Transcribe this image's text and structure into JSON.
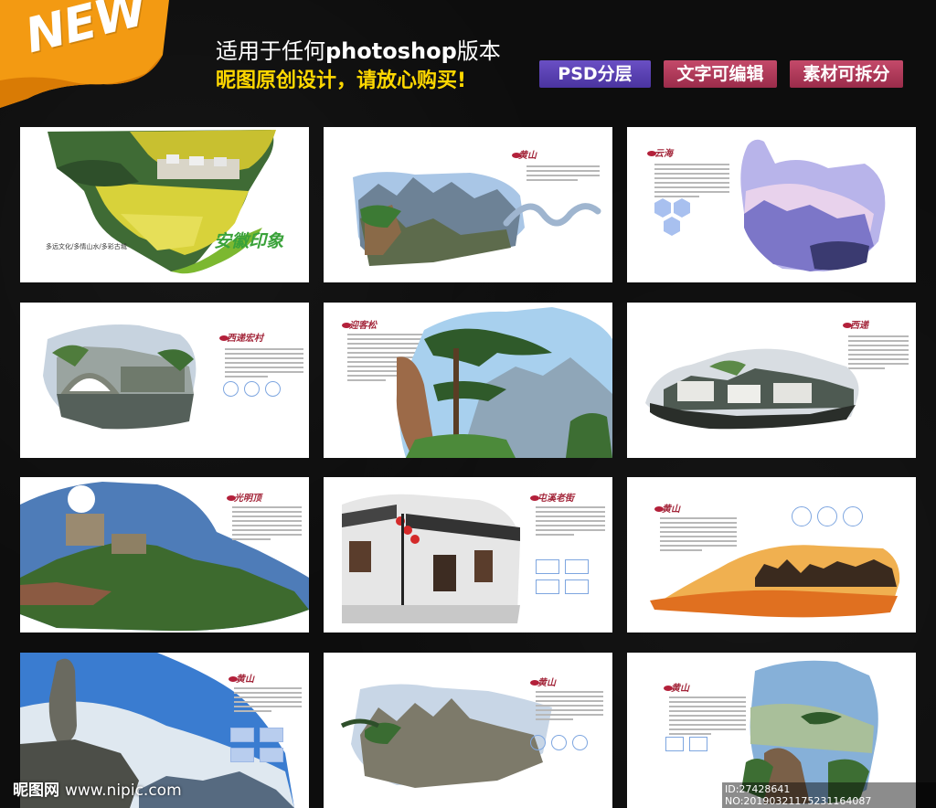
{
  "badge": {
    "label": "NEW",
    "color": "#f39a12"
  },
  "headline": {
    "line1_prefix": "适用于任何",
    "line1_bold": "photoshop",
    "line1_suffix": "版本",
    "line2": "昵图原创设计，请放心购买!"
  },
  "tags": [
    "PSD分层",
    "文字可编辑",
    "素材可拆分"
  ],
  "cards": [
    {
      "id": "cover",
      "title": "安徽印象",
      "subtitle": "多远文化/多情山水/多彩古城"
    },
    {
      "id": "huangshan-1",
      "title": "黄山"
    },
    {
      "id": "yunhai",
      "title": "云海"
    },
    {
      "id": "village-bridge",
      "title": "西递宏村"
    },
    {
      "id": "pine",
      "title": "迎客松"
    },
    {
      "id": "xidi",
      "title": "西递"
    },
    {
      "id": "guangmingding",
      "title": "光明顶"
    },
    {
      "id": "old-street",
      "title": "屯溪老街"
    },
    {
      "id": "sunset-peaks",
      "title": "黄山"
    },
    {
      "id": "peak-stone",
      "title": "黄山"
    },
    {
      "id": "cliffs",
      "title": "黄山"
    },
    {
      "id": "rock-tree",
      "title": "黄山"
    }
  ],
  "watermark": {
    "site": "昵图网",
    "url": "www.nipic.com",
    "id": "ID:27428641 NO:20190321175231164087"
  }
}
